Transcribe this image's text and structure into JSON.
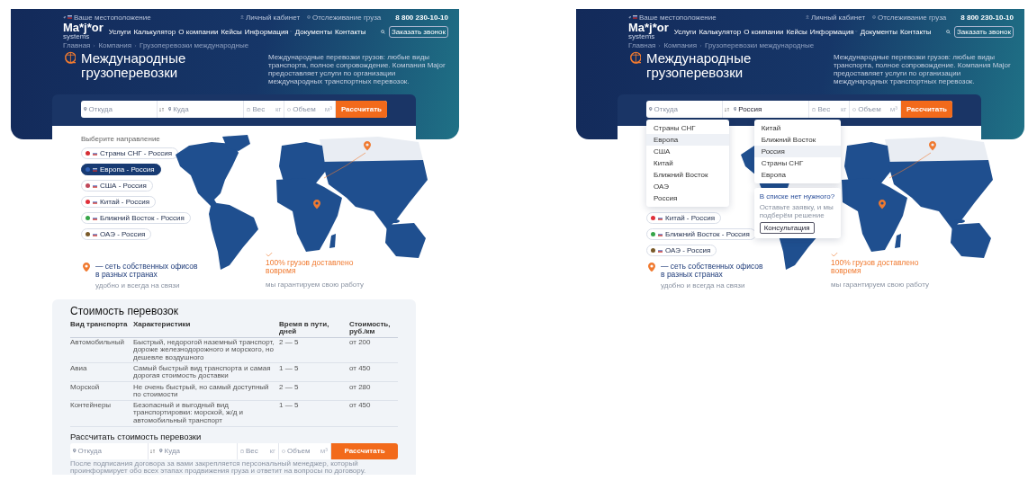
{
  "mockups": [
    {
      "top_bar": {
        "location": "Ваше местоположение",
        "account": "Личный кабинет",
        "tracking": "Отслеживание груза",
        "phone": "8 800 230-10-10"
      },
      "logo": {
        "name": "Ma*j*or",
        "sub": "systems"
      },
      "nav": [
        {
          "label": "Услуги",
          "has_menu": false
        },
        {
          "label": "Калькулятор",
          "has_menu": false
        },
        {
          "label": "О компании",
          "has_menu": false
        },
        {
          "label": "Кейсы",
          "has_menu": false
        },
        {
          "label": "Информация",
          "has_menu": true
        },
        {
          "label": "Документы",
          "has_menu": false
        },
        {
          "label": "Контакты",
          "has_menu": false
        }
      ],
      "callback_button": "Заказать звонок",
      "breadcrumbs": [
        "Главная",
        "Компания",
        "Грузоперевозки международные"
      ],
      "title": "Международные грузоперевозки",
      "description": "Международные перевозки грузов: любые виды транспорта, полное сопровождение. Компания Major предоставляет услуги по организации международных транспортных перевозок.",
      "search": {
        "from": {
          "placeholder": "Откуда"
        },
        "to": {
          "placeholder": "Куда"
        },
        "weight": {
          "placeholder": "Вес",
          "unit": "кг"
        },
        "volume": {
          "placeholder": "Объем",
          "unit": "м³"
        },
        "button": "Рассчитать"
      },
      "directions": {
        "heading": "Выберите направление",
        "items": [
          {
            "label": "Страны СНГ - Россия",
            "color": "#d62f35",
            "selected": false
          },
          {
            "label": "Европа - Россия",
            "color": "#2f5fb5",
            "selected": true
          },
          {
            "label": "США - Россия",
            "color": "#c0485a",
            "selected": false
          },
          {
            "label": "Китай - Россия",
            "color": "#e0303a",
            "selected": false
          },
          {
            "label": "Ближний Восток - Россия",
            "color": "#35a547",
            "selected": false
          },
          {
            "label": "ОАЭ - Россия",
            "color": "#7a5a2a",
            "selected": false
          }
        ]
      },
      "stats": [
        {
          "kind": "pin",
          "text": "— сеть собственных офисов в разных странах",
          "caption": "удобно и всегда на связи"
        },
        {
          "kind": "check",
          "text": "100% грузов доставлено вовремя",
          "caption": "мы гарантируем свою работу"
        }
      ],
      "pricing": {
        "title": "Стоимость перевозок",
        "columns": [
          "Вид транспорта",
          "Характеристики",
          "Время в пути, дней",
          "Стоимость, руб./км"
        ],
        "rows": [
          [
            "Автомобильный",
            "Быстрый, недорогой наземный транспорт, дороже железнодорожного и морского, но дешевле воздушного",
            "2 — 5",
            "от 200"
          ],
          [
            "Авиа",
            "Самый быстрый вид транспорта и самая дорогая стоимость доставки",
            "1 — 5",
            "от 450"
          ],
          [
            "Морской",
            "Не очень быстрый, но самый доступный по стоимости",
            "2 — 5",
            "от 280"
          ],
          [
            "Контейнеры",
            "Безопасный и выгодный вид транспортировки: морской, ж/д и автомобильный транспорт",
            "1 — 5",
            "от 450"
          ]
        ],
        "calc_title": "Рассчитать стоимость перевозки",
        "calc": {
          "from": {
            "placeholder": "Откуда"
          },
          "to": {
            "placeholder": "Куда"
          },
          "weight": {
            "placeholder": "Вес",
            "unit": "кг"
          },
          "volume": {
            "placeholder": "Объем",
            "unit": "м³"
          },
          "button": "Рассчитать"
        },
        "footnote": "После подписания договора за вами закрепляется персональный менеджер, который проинформирует обо всех этапах продвижения груза и ответит на вопросы по договору."
      }
    },
    {
      "top_bar": {
        "location": "Ваше местоположение",
        "account": "Личный кабинет",
        "tracking": "Отслеживание груза",
        "phone": "8 800 230-10-10"
      },
      "logo": {
        "name": "Ma*j*or",
        "sub": "systems"
      },
      "nav": [
        {
          "label": "Услуги",
          "has_menu": false
        },
        {
          "label": "Калькулятор",
          "has_menu": false
        },
        {
          "label": "О компании",
          "has_menu": false
        },
        {
          "label": "Кейсы",
          "has_menu": false
        },
        {
          "label": "Информация",
          "has_menu": true
        },
        {
          "label": "Документы",
          "has_menu": false
        },
        {
          "label": "Контакты",
          "has_menu": false
        }
      ],
      "callback_button": "Заказать звонок",
      "breadcrumbs": [
        "Главная",
        "Компания",
        "Грузоперевозки международные"
      ],
      "title": "Международные грузоперевозки",
      "description": "Международные перевозки грузов: любые виды транспорта, полное сопровождение. Компания Major предоставляет услуги по организации международных транспортных перевозок.",
      "search": {
        "from": {
          "placeholder": "Откуда",
          "options": [
            {
              "label": "Страны СНГ",
              "selected": false
            },
            {
              "label": "Европа",
              "selected": true
            },
            {
              "label": "США",
              "selected": false
            },
            {
              "label": "Китай",
              "selected": false
            },
            {
              "label": "Ближний Восток",
              "selected": false
            },
            {
              "label": "ОАЭ",
              "selected": false
            },
            {
              "label": "Россия",
              "selected": false
            }
          ]
        },
        "to": {
          "value": "Россия",
          "options": [
            {
              "label": "Китай",
              "selected": false
            },
            {
              "label": "Ближний Восток",
              "selected": false
            },
            {
              "label": "Россия",
              "selected": true
            },
            {
              "label": "Страны СНГ",
              "selected": false
            },
            {
              "label": "Европа",
              "selected": false
            }
          ],
          "help": {
            "title": "В списке нет нужного?",
            "text": "Оставьте заявку, и мы подберём решение",
            "button": "Консультация"
          }
        },
        "weight": {
          "placeholder": "Вес",
          "unit": "кг"
        },
        "volume": {
          "placeholder": "Объем",
          "unit": "м³"
        },
        "button": "Рассчитать"
      },
      "directions": {
        "items": [
          {
            "label": "Китай - Россия",
            "color": "#e0303a",
            "selected": false
          },
          {
            "label": "Ближний Восток - Россия",
            "color": "#35a547",
            "selected": false
          },
          {
            "label": "ОАЭ - Россия",
            "color": "#7a5a2a",
            "selected": false
          }
        ]
      },
      "stats": [
        {
          "kind": "pin",
          "text": "— сеть собственных офисов в разных странах",
          "caption": "удобно и всегда на связи"
        },
        {
          "kind": "check",
          "text": "100% грузов доставлено вовремя",
          "caption": "мы гарантируем свою работу"
        }
      ]
    }
  ]
}
